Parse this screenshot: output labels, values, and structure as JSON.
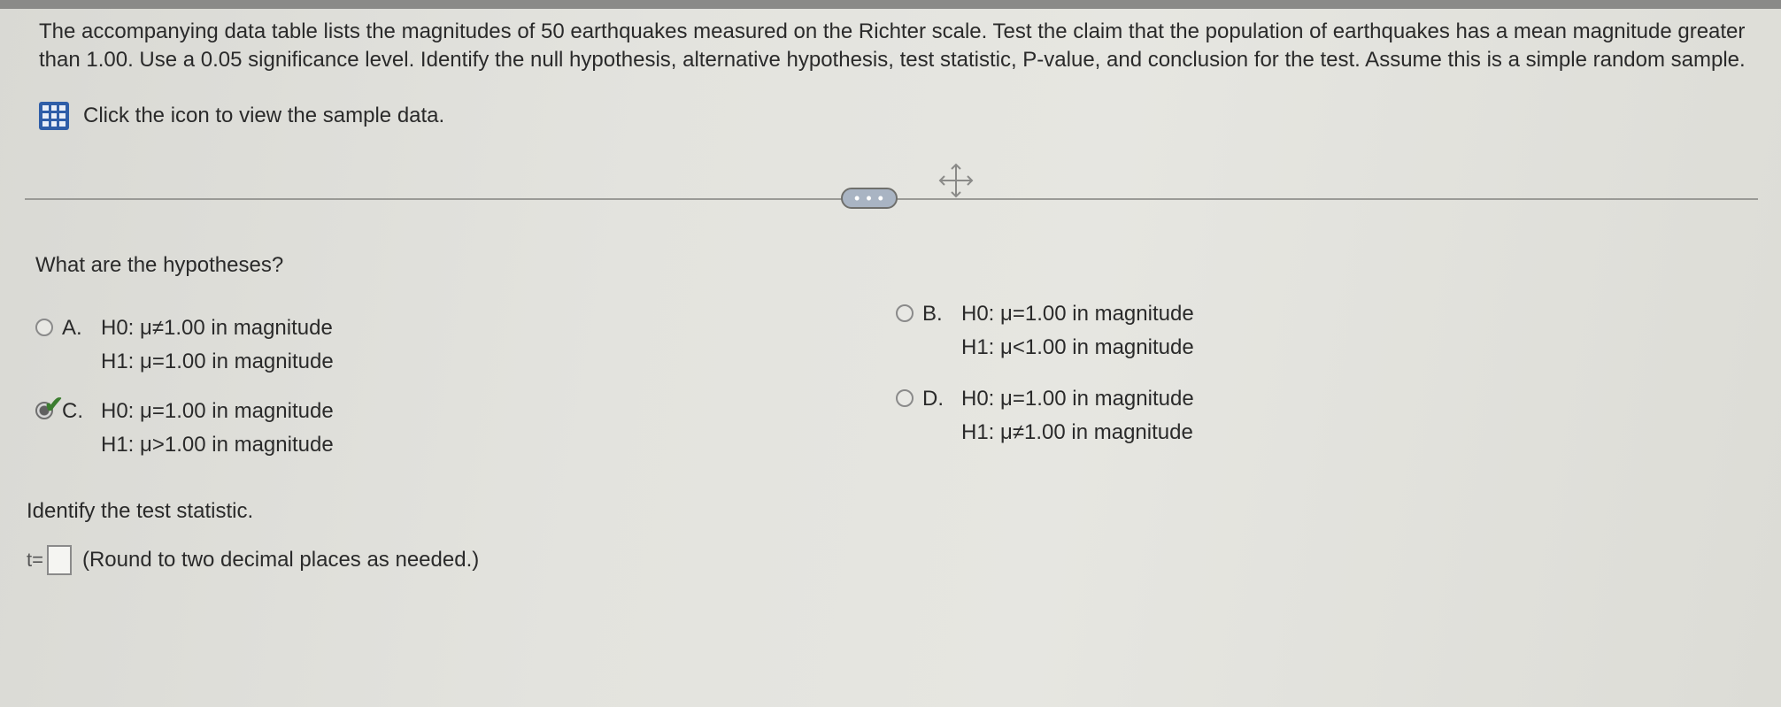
{
  "problem": {
    "text": "The accompanying data table lists the magnitudes of 50 earthquakes measured on the Richter scale. Test the claim that the population of earthquakes has a mean magnitude greater than 1.00. Use a 0.05 significance level. Identify the null hypothesis, alternative hypothesis, test statistic, P-value, and conclusion for the test. Assume this is a simple random sample.",
    "sample_link": "Click the icon to view the sample data.",
    "sample_icon": "data-table-icon"
  },
  "toolbar": {
    "more_label": "• • •",
    "move_icon": "move-icon"
  },
  "question": {
    "prompt": "What are the hypotheses?",
    "options": [
      {
        "letter": "A.",
        "h0": "H0: μ≠1.00 in magnitude",
        "h1": "H1: μ=1.00 in magnitude",
        "selected": false
      },
      {
        "letter": "B.",
        "h0": "H0: μ=1.00 in magnitude",
        "h1": "H1: μ<1.00 in magnitude",
        "selected": false
      },
      {
        "letter": "C.",
        "h0": "H0: μ=1.00 in magnitude",
        "h1": "H1: μ>1.00 in magnitude",
        "selected": true
      },
      {
        "letter": "D.",
        "h0": "H0: μ=1.00 in magnitude",
        "h1": "H1: μ≠1.00 in magnitude",
        "selected": false
      }
    ]
  },
  "test_statistic": {
    "prompt": "Identify the test statistic.",
    "label": "t=",
    "value": "",
    "hint": "(Round to two decimal places as needed.)"
  },
  "colors": {
    "icon_blue": "#2f5ea8",
    "check_green": "#3b7d2f"
  }
}
